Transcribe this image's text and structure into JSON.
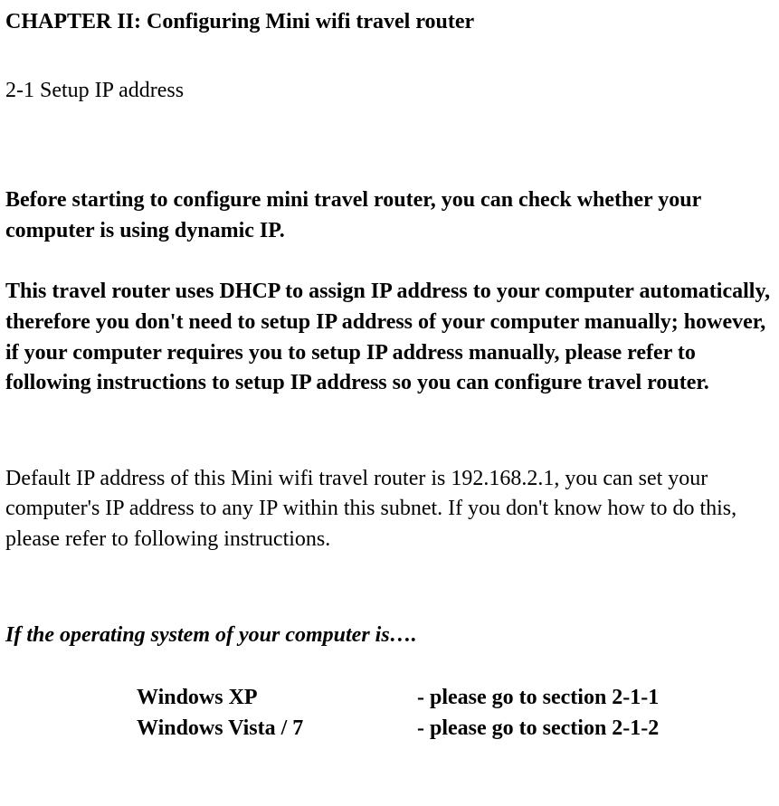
{
  "chapter_title": "CHAPTER II:    Configuring Mini wifi travel router",
  "section_title": "2-1 Setup IP address",
  "para1": "Before starting to configure mini travel router, you can check whether your computer is using dynamic IP.",
  "para2": "This travel router uses DHCP to assign IP address to your computer automatically, therefore you don't need to setup IP address of your computer manually; however, if your computer requires you to setup IP address manually, please refer to following instructions to setup IP address so you can configure travel router.",
  "para3": "Default IP address of this Mini wifi travel router is 192.168.2.1, you can set your computer's IP address to any IP within this subnet. If you don't know how to do this, please refer to following instructions.",
  "os_heading": "If the operating system of your computer is….",
  "os_list": [
    {
      "name": "Windows XP",
      "ref": "- please go to section 2-1-1"
    },
    {
      "name": "Windows Vista / 7",
      "ref": "- please go to section 2-1-2"
    }
  ]
}
